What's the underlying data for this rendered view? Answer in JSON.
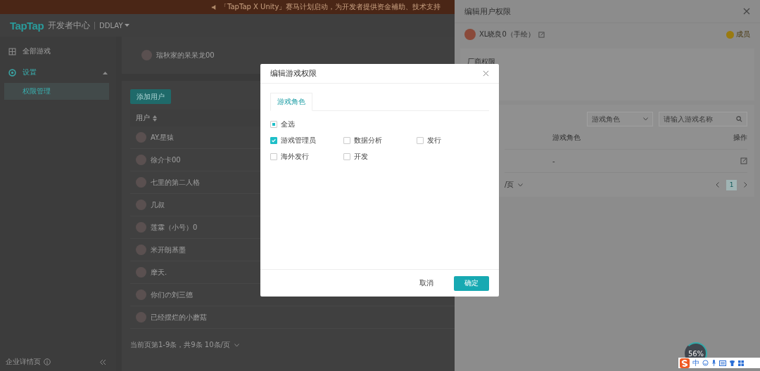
{
  "banner": {
    "text": "「TapTap X Unity」赛马计划启动，为开发者提供资金補助、技术支持"
  },
  "header": {
    "logo": "TapTap",
    "product": "开发者中心",
    "account": "DDLAY"
  },
  "sidebar": {
    "items": [
      {
        "label": "全部游戏",
        "selected": false
      },
      {
        "label": "设置",
        "selected": true,
        "expanded": true,
        "children": [
          {
            "label": "权限管理",
            "selected": true
          }
        ]
      }
    ],
    "footer": "企业详情页"
  },
  "top_card": {
    "user": "瑞秋家的呆呆龙00"
  },
  "users_card": {
    "add_button": "添加用户",
    "column": "用户",
    "rows": [
      "AY.星猿",
      "徐介卡00",
      "七里的第二人格",
      "几叔",
      "莲霖（小号）0",
      "米开朗基墨",
      "摩天.",
      "你们の刘三德",
      "已经摆烂的小蘑菇"
    ],
    "footer": "当前页第1-9条，共9条  10条/页"
  },
  "drawer": {
    "title": "编辑用户权限",
    "user": "XL晓良0（手绘）",
    "badge": "成员",
    "section": "厂商权限",
    "filter": {
      "placeholder": "游戏角色"
    },
    "search": {
      "placeholder": "请输入游戏名称"
    },
    "columns": [
      "游戏角色",
      "操作"
    ],
    "rows": [
      {
        "role": "-"
      }
    ],
    "page_size": "/页",
    "pages": [
      {
        "label": "1",
        "selected": true
      }
    ]
  },
  "modal": {
    "title": "编辑游戏权限",
    "tabs": [
      {
        "label": "游戏角色",
        "selected": true
      }
    ],
    "select_all": {
      "label": "全选",
      "indeterminate": true
    },
    "options": [
      {
        "label": "游戏管理员",
        "checked": true
      },
      {
        "label": "数据分析",
        "checked": false
      },
      {
        "label": "发行",
        "checked": false
      },
      {
        "label": "海外发行",
        "checked": false
      },
      {
        "label": "开发",
        "checked": false
      }
    ],
    "buttons": [
      {
        "label": "取消",
        "kind": "secondary"
      },
      {
        "label": "确定",
        "kind": "primary"
      }
    ]
  },
  "widgets": {
    "gauge": "56%",
    "ime": "中"
  }
}
